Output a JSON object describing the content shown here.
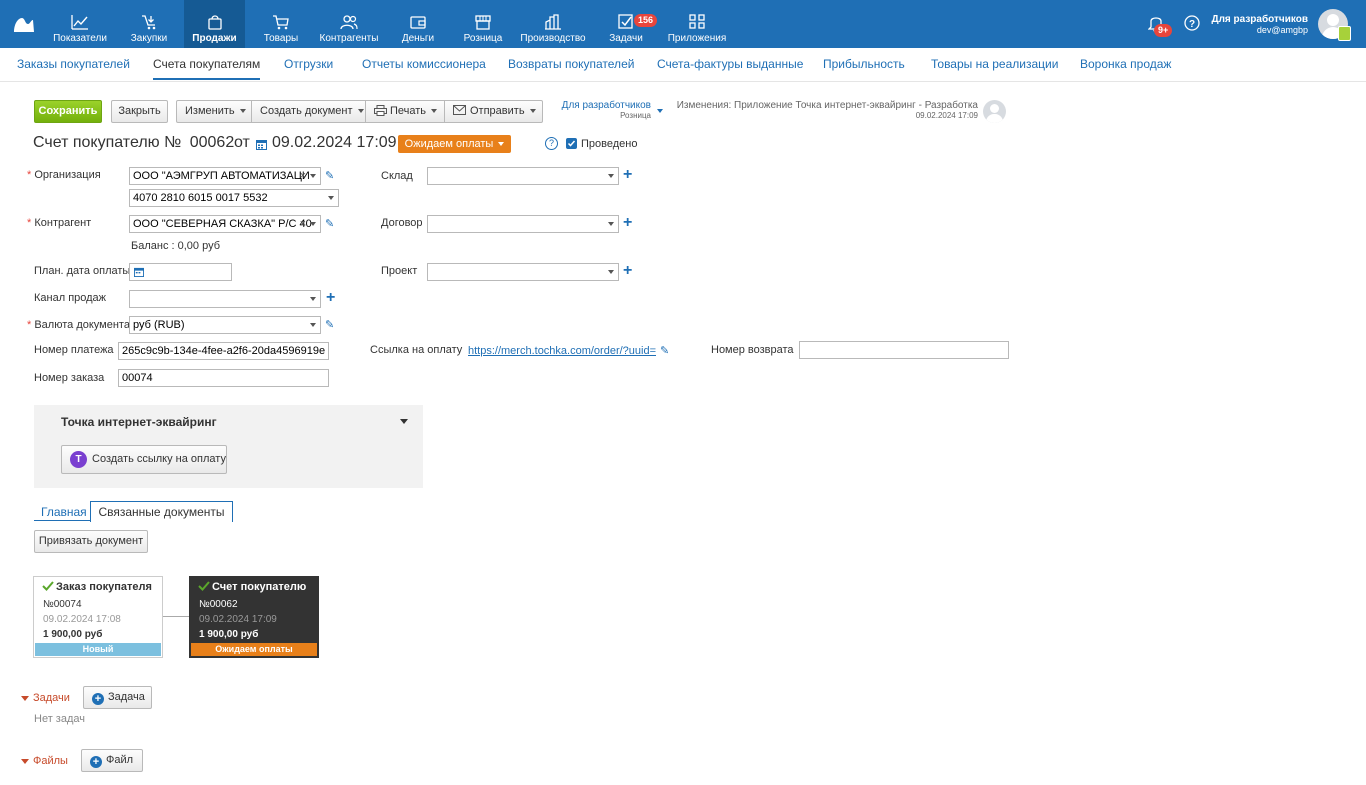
{
  "topnav": {
    "items": [
      {
        "label": "Показатели",
        "icon": "chart-line-icon"
      },
      {
        "label": "Закупки",
        "icon": "cart-arrow-icon"
      },
      {
        "label": "Продажи",
        "icon": "bag-icon"
      },
      {
        "label": "Товары",
        "icon": "shopping-cart-icon"
      },
      {
        "label": "Контрагенты",
        "icon": "users-icon"
      },
      {
        "label": "Деньги",
        "icon": "wallet-icon"
      },
      {
        "label": "Розница",
        "icon": "store-icon"
      },
      {
        "label": "Производство",
        "icon": "factory-icon"
      },
      {
        "label": "Задачи",
        "icon": "check-square-icon",
        "badge": "156"
      },
      {
        "label": "Приложения",
        "icon": "apps-icon"
      }
    ],
    "notifications_badge": "9+",
    "user_name": "Для разработчиков",
    "user_login": "dev@amgbp"
  },
  "subnav": {
    "items": [
      "Заказы покупателей",
      "Счета покупателям",
      "Отгрузки",
      "Отчеты комиссионера",
      "Возвраты покупателей",
      "Счета-фактуры выданные",
      "Прибыльность",
      "Товары на реализации",
      "Воронка продаж"
    ]
  },
  "toolbar": {
    "save": "Сохранить",
    "close": "Закрыть",
    "edit": "Изменить",
    "create_doc": "Создать документ",
    "print": "Печать",
    "send": "Отправить",
    "owner": "Для разработчиков",
    "owner_sub": "Розница",
    "changes": "Изменения: Приложение Точка интернет-эквайринг - Разработка",
    "changes_date": "09.02.2024 17:09"
  },
  "doc": {
    "title": "Счет покупателю №",
    "number": "00062",
    "from": "от",
    "date": "09.02.2024 17:09",
    "status": "Ожидаем оплаты",
    "posted_label": "Проведено",
    "posted": true
  },
  "form": {
    "org_label": "Организация",
    "org_value": "ООО \"АЭМГРУП АВТОМАТИЗАЦИ",
    "account_value": "4070 2810 6015 0017 5532",
    "counterparty_label": "Контрагент",
    "counterparty_value": "ООО \"СЕВЕРНАЯ СКАЗКА\" Р/С 40",
    "balance": "Баланс : 0,00 руб",
    "plan_date_label": "План. дата оплаты",
    "channel_label": "Канал продаж",
    "currency_label": "Валюта документа",
    "currency_value": "руб (RUB)",
    "payment_no_label": "Номер платежа",
    "payment_no_value": "265c9c9b-134e-4fee-a2f6-20da4596919e",
    "order_no_label": "Номер заказа",
    "order_no_value": "00074",
    "warehouse_label": "Склад",
    "contract_label": "Договор",
    "project_label": "Проект",
    "pay_link_label": "Ссылка на оплату",
    "pay_link_value": "https://merch.tochka.com/order/?uuid=…",
    "return_no_label": "Номер возврата"
  },
  "acquiring": {
    "title": "Точка интернет-эквайринг",
    "create_link": "Создать ссылку на оплату"
  },
  "tabs": {
    "main": "Главная",
    "linked": "Связанные документы"
  },
  "link_doc_button": "Привязать документ",
  "linked_docs": [
    {
      "title": "Заказ покупателя",
      "number": "№00074",
      "date": "09.02.2024 17:08",
      "sum": "1 900,00 руб",
      "status": "Новый"
    },
    {
      "title": "Счет покупателю",
      "number": "№00062",
      "date": "09.02.2024 17:09",
      "sum": "1 900,00 руб",
      "status": "Ожидаем оплаты"
    }
  ],
  "tasks": {
    "label": "Задачи",
    "add": "Задача",
    "empty": "Нет задач"
  },
  "files": {
    "label": "Файлы",
    "add": "Файл"
  }
}
